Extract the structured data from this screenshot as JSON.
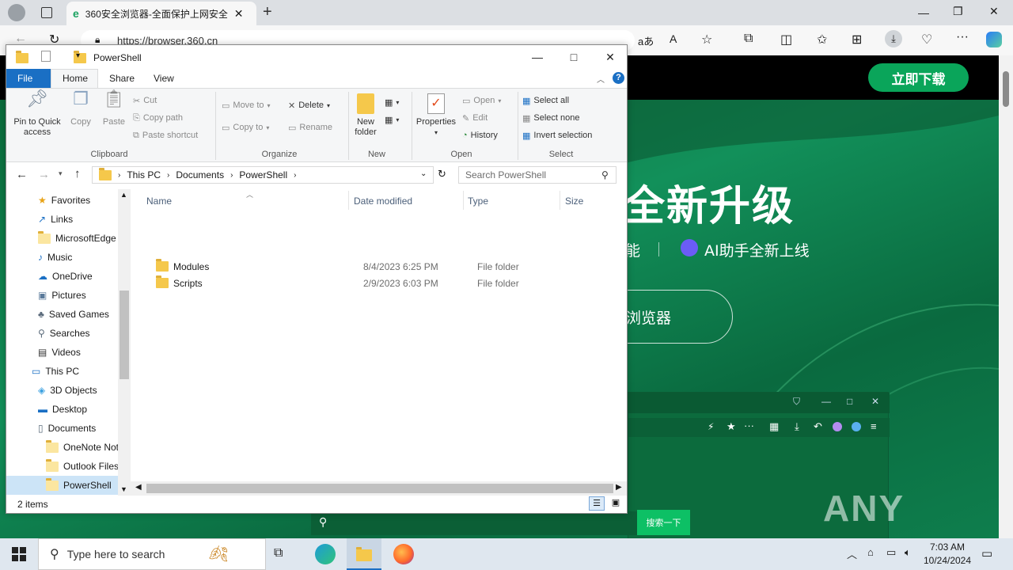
{
  "browser": {
    "tab_title": "360安全浏览器-全面保护上网安全",
    "new_tab_symbol": "+",
    "address": "https://browser.360.cn",
    "page": {
      "download_button": "立即下载",
      "headline": "全新升级",
      "sub_left": "能",
      "sub_right": "AI助手全新上线",
      "pill_text": "浏览器",
      "search_button": "搜索一下",
      "watermark": "ANY RUN"
    }
  },
  "explorer": {
    "title": "PowerShell",
    "ribbon_tabs": [
      "File",
      "Home",
      "Share",
      "View"
    ],
    "clipboard": {
      "label": "Clipboard",
      "pin": "Pin to Quick access",
      "copy": "Copy",
      "paste": "Paste",
      "cut": "Cut",
      "copy_path": "Copy path",
      "paste_shortcut": "Paste shortcut"
    },
    "organize": {
      "label": "Organize",
      "move_to": "Move to",
      "copy_to": "Copy to",
      "delete": "Delete",
      "rename": "Rename"
    },
    "new": {
      "label": "New",
      "new_folder": "New folder"
    },
    "open": {
      "label": "Open",
      "properties": "Properties",
      "open": "Open",
      "edit": "Edit",
      "history": "History"
    },
    "select": {
      "label": "Select",
      "select_all": "Select all",
      "select_none": "Select none",
      "invert": "Invert selection"
    },
    "breadcrumb": [
      "This PC",
      "Documents",
      "PowerShell"
    ],
    "search_placeholder": "Search PowerShell",
    "nav_items": [
      {
        "label": "Favorites",
        "icon": "star-icon",
        "indent": 1
      },
      {
        "label": "Links",
        "icon": "link-icon",
        "indent": 1
      },
      {
        "label": "MicrosoftEdge",
        "icon": "folder-icon",
        "indent": 1
      },
      {
        "label": "Music",
        "icon": "music-icon",
        "indent": 1
      },
      {
        "label": "OneDrive",
        "icon": "cloud-icon",
        "indent": 1
      },
      {
        "label": "Pictures",
        "icon": "pictures-icon",
        "indent": 1
      },
      {
        "label": "Saved Games",
        "icon": "games-icon",
        "indent": 1
      },
      {
        "label": "Searches",
        "icon": "search-icon",
        "indent": 1
      },
      {
        "label": "Videos",
        "icon": "video-icon",
        "indent": 1
      },
      {
        "label": "This PC",
        "icon": "computer-icon",
        "indent": 0
      },
      {
        "label": "3D Objects",
        "icon": "cube-icon",
        "indent": 1
      },
      {
        "label": "Desktop",
        "icon": "desktop-icon",
        "indent": 1
      },
      {
        "label": "Documents",
        "icon": "documents-icon",
        "indent": 1
      },
      {
        "label": "OneNote Not",
        "icon": "folder-icon",
        "indent": 2
      },
      {
        "label": "Outlook Files",
        "icon": "folder-icon",
        "indent": 2
      },
      {
        "label": "PowerShell",
        "icon": "folder-icon",
        "indent": 2,
        "selected": true
      }
    ],
    "columns": [
      "Name",
      "Date modified",
      "Type",
      "Size"
    ],
    "files": [
      {
        "name": "Modules",
        "date": "8/4/2023 6:25 PM",
        "type": "File folder",
        "size": ""
      },
      {
        "name": "Scripts",
        "date": "2/9/2023 6:03 PM",
        "type": "File folder",
        "size": ""
      }
    ],
    "status": "2 items"
  },
  "taskbar": {
    "search_placeholder": "Type here to search",
    "time": "7:03 AM",
    "date": "10/24/2024"
  }
}
